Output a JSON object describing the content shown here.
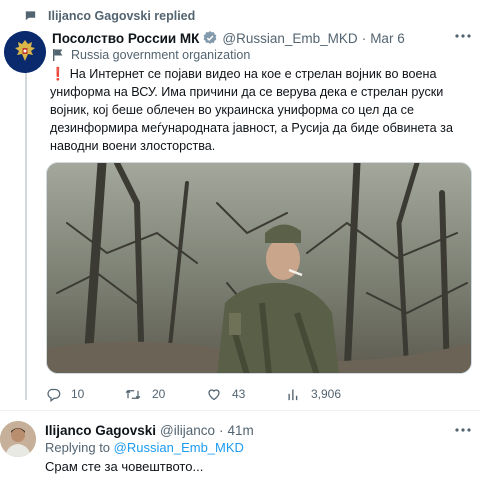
{
  "context": {
    "replied_text": "Ilijanco Gagovski replied"
  },
  "original_tweet": {
    "display_name": "Посолство России МК",
    "handle": "@Russian_Emb_MKD",
    "separator": "·",
    "date": "Mar 6",
    "org_label": "Russia government organization",
    "text": "На Интернет се појави видео на кое е стрелан војник во воена униформа на ВСУ. Има причини да се верува дека е стрелан руски војник, кој беше облечен во украинска униформа со цел да се дезинформира меѓународната јавност, а Русија да биде обвинета за наводни воени злосторства.",
    "media_alt": "soldier-in-forest-photo",
    "stats": {
      "replies": "10",
      "retweets": "20",
      "likes": "43",
      "views": "3,906"
    }
  },
  "reply_tweet": {
    "display_name": "Ilijanco Gagovski",
    "handle": "@ilijanco",
    "separator": "·",
    "time": "41m",
    "replying_prefix": "Replying to",
    "replying_handle": "@Russian_Emb_MKD",
    "text": "Срам сте за човештвото..."
  },
  "icons": {
    "replied": "speech-bubble-icon",
    "verified": "verified-gray-badge-icon",
    "org": "flag-icon",
    "alert": "exclamation-icon",
    "more": "more-dots-icon",
    "reply": "reply-icon",
    "retweet": "retweet-icon",
    "like": "heart-icon",
    "views": "views-bar-chart-icon"
  },
  "colors": {
    "text_primary": "#0f1419",
    "text_secondary": "#536471",
    "link": "#1d9bf0",
    "alert": "#e0245e",
    "verified_gray": "#829aab",
    "divider": "#eff3f4"
  }
}
